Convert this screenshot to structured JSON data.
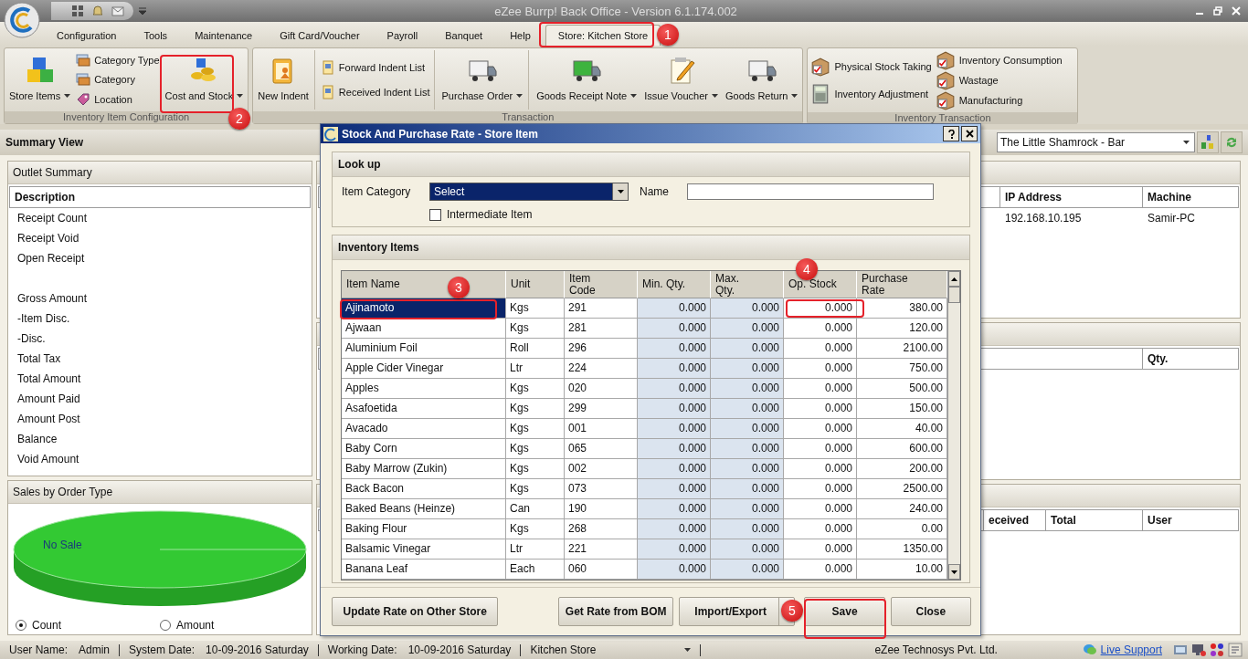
{
  "window": {
    "title": "eZee Burrp! Back Office - Version 6.1.174.002"
  },
  "menu": [
    {
      "label": "Configuration",
      "selected": false
    },
    {
      "label": "Tools",
      "selected": false
    },
    {
      "label": "Maintenance",
      "selected": false
    },
    {
      "label": "Gift Card/Voucher",
      "selected": false
    },
    {
      "label": "Payroll",
      "selected": false
    },
    {
      "label": "Banquet",
      "selected": false
    },
    {
      "label": "Help",
      "selected": false
    },
    {
      "label": "Store: Kitchen Store",
      "selected": true
    }
  ],
  "ribbon": {
    "groups": [
      {
        "label": "Inventory Item Configuration",
        "columns": [
          [
            {
              "label": "Store Items",
              "dropdown": true
            }
          ],
          [
            {
              "label": "Category Type"
            },
            {
              "label": "Category"
            },
            {
              "label": "Location"
            }
          ],
          [
            {
              "label": "Cost and Stock",
              "dropdown": true
            }
          ]
        ]
      },
      {
        "label": "Transaction",
        "columns": [
          [
            {
              "label": "New Indent",
              "dropdown": false
            }
          ],
          [
            {
              "label": "Forward Indent List"
            },
            {
              "label": "Received Indent List"
            }
          ],
          [
            {
              "label": "Purchase Order",
              "dropdown": true
            }
          ],
          [
            {
              "label": "Goods Receipt Note",
              "dropdown": true
            }
          ],
          [
            {
              "label": "Issue Voucher",
              "dropdown": true
            }
          ],
          [
            {
              "label": "Goods Return",
              "dropdown": true
            }
          ]
        ]
      },
      {
        "label": "Inventory Transaction",
        "columns": [
          [
            {
              "label": "Physical Stock Taking"
            },
            {
              "label": "Inventory Adjustment"
            }
          ],
          [
            {
              "label": "Inventory Consumption"
            },
            {
              "label": "Wastage"
            },
            {
              "label": "Manufacturing"
            }
          ]
        ]
      }
    ]
  },
  "summary_view": {
    "title": "Summary View",
    "outlet": "The Little Shamrock - Bar"
  },
  "outlet_summary": {
    "title": "Outlet Summary",
    "column": "Description",
    "row_groups": [
      [
        "Receipt Count",
        "Receipt Void",
        "Open Receipt"
      ],
      [
        "Gross Amount",
        "-Item Disc.",
        "-Disc.",
        "Total Tax",
        "Total Amount",
        "Amount Paid",
        "Amount Post",
        "Balance",
        "Void Amount"
      ]
    ]
  },
  "sales_by_order_type": {
    "title": "Sales by Order Type",
    "pie_label": "No Sale",
    "options": [
      {
        "label": "Count",
        "selected": true
      },
      {
        "label": "Amount",
        "selected": false
      }
    ]
  },
  "right_panels": [
    {
      "columns": [
        "IP Address",
        "Machine"
      ],
      "rows": [
        [
          "192.168.10.195",
          "Samir-PC"
        ]
      ]
    },
    {
      "columns": [
        "Qty."
      ]
    },
    {
      "columns": [
        "eceived",
        "Total",
        "User"
      ]
    }
  ],
  "dialog": {
    "title": "Stock And Purchase Rate - Store Item",
    "lookup": {
      "title": "Look up",
      "category_label": "Item Category",
      "category_value": "Select",
      "name_label": "Name",
      "intermediate": {
        "label": "Intermediate Item",
        "checked": false
      }
    },
    "items": {
      "title": "Inventory Items",
      "columns": [
        "Item Name",
        "Unit",
        "Item\nCode",
        "Min. Qty.",
        "Max.\nQty.",
        "Op. Stock",
        "Purchase\nRate"
      ],
      "rows": [
        {
          "selected": true,
          "cells": [
            "Ajinamoto",
            "Kgs",
            "291",
            "0.000",
            "0.000",
            "0.000",
            "380.00"
          ]
        },
        {
          "selected": false,
          "cells": [
            "Ajwaan",
            "Kgs",
            "281",
            "0.000",
            "0.000",
            "0.000",
            "120.00"
          ]
        },
        {
          "selected": false,
          "cells": [
            "Aluminium Foil",
            "Roll",
            "296",
            "0.000",
            "0.000",
            "0.000",
            "2100.00"
          ]
        },
        {
          "selected": false,
          "cells": [
            "Apple Cider Vinegar",
            "Ltr",
            "224",
            "0.000",
            "0.000",
            "0.000",
            "750.00"
          ]
        },
        {
          "selected": false,
          "cells": [
            "Apples",
            "Kgs",
            "020",
            "0.000",
            "0.000",
            "0.000",
            "500.00"
          ]
        },
        {
          "selected": false,
          "cells": [
            "Asafoetida",
            "Kgs",
            "299",
            "0.000",
            "0.000",
            "0.000",
            "150.00"
          ]
        },
        {
          "selected": false,
          "cells": [
            "Avacado",
            "Kgs",
            "001",
            "0.000",
            "0.000",
            "0.000",
            "40.00"
          ]
        },
        {
          "selected": false,
          "cells": [
            "Baby Corn",
            "Kgs",
            "065",
            "0.000",
            "0.000",
            "0.000",
            "600.00"
          ]
        },
        {
          "selected": false,
          "cells": [
            "Baby Marrow (Zukin)",
            "Kgs",
            "002",
            "0.000",
            "0.000",
            "0.000",
            "200.00"
          ]
        },
        {
          "selected": false,
          "cells": [
            "Back Bacon",
            "Kgs",
            "073",
            "0.000",
            "0.000",
            "0.000",
            "2500.00"
          ]
        },
        {
          "selected": false,
          "cells": [
            "Baked Beans (Heinze)",
            "Can",
            "190",
            "0.000",
            "0.000",
            "0.000",
            "240.00"
          ]
        },
        {
          "selected": false,
          "cells": [
            "Baking Flour",
            "Kgs",
            "268",
            "0.000",
            "0.000",
            "0.000",
            "0.00"
          ]
        },
        {
          "selected": false,
          "cells": [
            "Balsamic Vinegar",
            "Ltr",
            "221",
            "0.000",
            "0.000",
            "0.000",
            "1350.00"
          ]
        },
        {
          "selected": false,
          "cells": [
            "Banana Leaf",
            "Each",
            "060",
            "0.000",
            "0.000",
            "0.000",
            "10.00"
          ]
        }
      ]
    },
    "buttons": [
      {
        "label": "Update Rate on Other Store",
        "dropdown": false
      },
      {
        "label": "Get Rate from BOM",
        "dropdown": false
      },
      {
        "label": "Import/Export",
        "dropdown": true
      },
      {
        "label": "Save",
        "dropdown": false
      },
      {
        "label": "Close",
        "dropdown": false
      }
    ]
  },
  "status_bar": {
    "user_label": "User Name:",
    "user": "Admin",
    "system_date_label": "System Date:",
    "system_date": "10-09-2016 Saturday",
    "working_date_label": "Working Date:",
    "working_date": "10-09-2016 Saturday",
    "store": "Kitchen Store",
    "company": "eZee Technosys Pvt. Ltd.",
    "live_support": "Live Support"
  },
  "annotations": [
    "1",
    "2",
    "3",
    "4",
    "5"
  ]
}
